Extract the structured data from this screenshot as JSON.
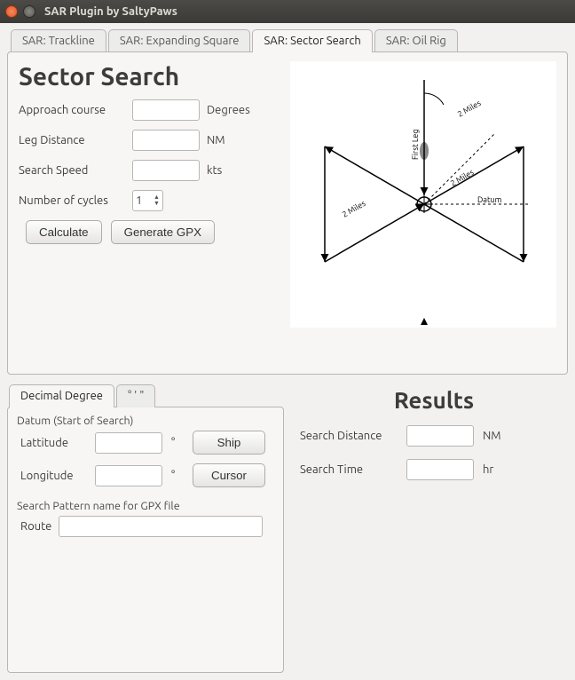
{
  "window": {
    "title": "SAR Plugin by SaltyPaws"
  },
  "tabs": [
    {
      "label": "SAR: Trackline"
    },
    {
      "label": "SAR: Expanding Square"
    },
    {
      "label": "SAR: Sector Search"
    },
    {
      "label": "SAR: Oil Rig"
    }
  ],
  "active_tab": 2,
  "sector": {
    "heading": "Sector Search",
    "fields": {
      "approach": {
        "label": "Approach course",
        "value": "",
        "unit": "Degrees"
      },
      "leg": {
        "label": "Leg Distance",
        "value": "",
        "unit": "NM"
      },
      "speed": {
        "label": "Search Speed",
        "value": "",
        "unit": "kts"
      },
      "cycles": {
        "label": "Number of cycles",
        "value": "1"
      }
    },
    "buttons": {
      "calculate": "Calculate",
      "generate": "Generate GPX"
    },
    "diagram_labels": {
      "first_leg": "First Leg",
      "two_miles": "2 Miles",
      "datum": "Datum"
    }
  },
  "coord_tabs": [
    {
      "label": "Decimal Degree"
    },
    {
      "label": "° ' \""
    }
  ],
  "coord_active": 0,
  "datum": {
    "group": "Datum (Start of Search)",
    "lat": {
      "label": "Lattitude",
      "value": "",
      "unit": "°"
    },
    "lon": {
      "label": "Longitude",
      "value": "",
      "unit": "°"
    },
    "ship_btn": "Ship",
    "cursor_btn": "Cursor"
  },
  "gpx": {
    "group": "Search Pattern name for GPX file",
    "route_label": "Route",
    "route_value": ""
  },
  "results": {
    "heading": "Results",
    "distance": {
      "label": "Search Distance",
      "value": "",
      "unit": "NM"
    },
    "time": {
      "label": "Search Time",
      "value": "",
      "unit": "hr"
    }
  }
}
